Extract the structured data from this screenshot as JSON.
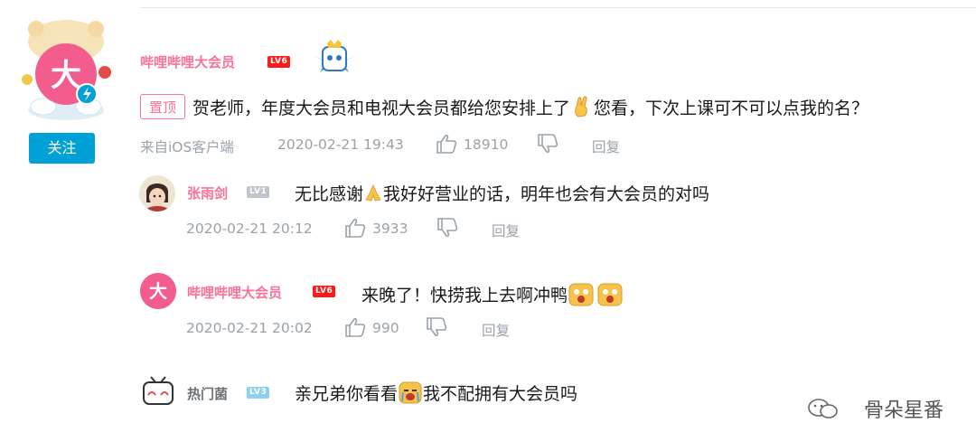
{
  "main_comment": {
    "user": "哔哩哔哩大会员",
    "level": "LV6",
    "follow_label": "关注",
    "pin_label": "置顶",
    "text_a": "贺老师，年度大会员和电视大会员都给您安排上了",
    "text_b": "您看，下次上课可不可以点我的名？",
    "avatar_char": "大",
    "source": "来自iOS客户端",
    "time": "2020-02-21 19:43",
    "likes": "18910",
    "reply_label": "回复"
  },
  "replies": [
    {
      "user": "张雨剑",
      "level": "LV1",
      "text_a": "无比感谢",
      "text_b": "我好好营业的话，明年也会有大会员的对吗",
      "time": "2020-02-21 20:12",
      "likes": "3933",
      "reply_label": "回复"
    },
    {
      "user": "哔哩哔哩大会员",
      "level": "LV6",
      "avatar_char": "大",
      "text_a": "来晚了！快捞我上去啊冲鸭",
      "time": "2020-02-21 20:02",
      "likes": "990",
      "reply_label": "回复"
    },
    {
      "user": "热门菌",
      "level": "LV3",
      "text_a": "亲兄弟你看看",
      "text_b": "我不配拥有大会员吗"
    }
  ],
  "watermark": "骨朵星番",
  "colors": {
    "pink": "#fb7299",
    "blue": "#00a1d6",
    "gray": "#99a2aa"
  }
}
